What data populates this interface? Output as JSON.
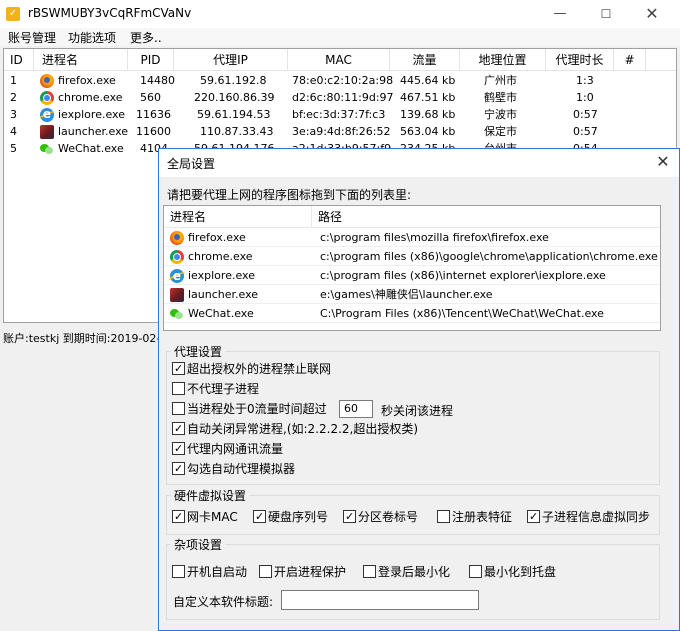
{
  "main_window": {
    "title": "rBSWMUBY3vCqRFmCVaNv",
    "app_icon": "checkmark-shield-icon",
    "menu": [
      "账号管理",
      "功能选项",
      "更多.."
    ],
    "columns": [
      "ID",
      "进程名",
      "PID",
      "代理IP",
      "MAC",
      "流量",
      "地理位置",
      "代理时长",
      "#"
    ],
    "rows": [
      {
        "id": "1",
        "icon": "firefox",
        "name": "firefox.exe",
        "pid": "14480",
        "ip": "59.61.192.8",
        "mac": "78:e0:c2:10:2a:98",
        "traffic": "445.64 kb",
        "location": "广州市",
        "duration": "1:3"
      },
      {
        "id": "2",
        "icon": "chrome",
        "name": "chrome.exe",
        "pid": "560",
        "ip": "220.160.86.39",
        "mac": "d2:6c:80:11:9d:97",
        "traffic": "467.51 kb",
        "location": "鹤壁市",
        "duration": "1:0"
      },
      {
        "id": "3",
        "icon": "ie",
        "name": "iexplore.exe",
        "pid": "11636",
        "ip": "59.61.194.53",
        "mac": "bf:ec:3d:37:7f:c3",
        "traffic": "139.68 kb",
        "location": "宁波市",
        "duration": "0:57"
      },
      {
        "id": "4",
        "icon": "launcher",
        "name": "launcher.exe",
        "pid": "11600",
        "ip": "110.87.33.43",
        "mac": "3e:a9:4d:8f:26:52",
        "traffic": "563.04 kb",
        "location": "保定市",
        "duration": "0:57"
      },
      {
        "id": "5",
        "icon": "wechat",
        "name": "WeChat.exe",
        "pid": "4104",
        "ip": "59.61.194.176",
        "mac": "a2:1d:33:b9:57:f9",
        "traffic": "234.25 kb",
        "location": "台州市",
        "duration": "0:54"
      }
    ],
    "status": "账户:testkj  到期时间:2019-02-"
  },
  "dialog": {
    "title": "全局设置",
    "prompt": "请把要代理上网的程序图标拖到下面的列表里:",
    "list_columns": [
      "进程名",
      "路径"
    ],
    "list_rows": [
      {
        "icon": "firefox",
        "name": "firefox.exe",
        "path": "c:\\program files\\mozilla firefox\\firefox.exe"
      },
      {
        "icon": "chrome",
        "name": "chrome.exe",
        "path": "c:\\program files (x86)\\google\\chrome\\application\\chrome.exe"
      },
      {
        "icon": "ie",
        "name": "iexplore.exe",
        "path": "c:\\program files (x86)\\internet explorer\\iexplore.exe"
      },
      {
        "icon": "launcher",
        "name": "launcher.exe",
        "path": "e:\\games\\神雕侠侣\\launcher.exe"
      },
      {
        "icon": "wechat",
        "name": "WeChat.exe",
        "path": "C:\\Program Files (x86)\\Tencent\\WeChat\\WeChat.exe"
      }
    ],
    "proxy_group": {
      "title": "代理设置",
      "opt_block_unauthorized": {
        "label": "超出授权外的进程禁止联网",
        "checked": true
      },
      "opt_no_child": {
        "label": "不代理子进程",
        "checked": false
      },
      "opt_idle_close_pre": {
        "label": "当进程处于0流量时间超过",
        "checked": false
      },
      "idle_seconds": "60",
      "opt_idle_close_post": "秒关闭该进程",
      "opt_auto_close": {
        "label": "自动关闭异常进程,(如:2.2.2.2,超出授权类)",
        "checked": true
      },
      "opt_lan_traffic": {
        "label": "代理内网通讯流量",
        "checked": true
      },
      "opt_auto_emulator": {
        "label": "勾选自动代理模拟器",
        "checked": true
      }
    },
    "hardware_group": {
      "title": "硬件虚拟设置",
      "opt_nic_mac": {
        "label": "网卡MAC",
        "checked": true
      },
      "opt_disk_serial": {
        "label": "硬盘序列号",
        "checked": true
      },
      "opt_volume_id": {
        "label": "分区卷标号",
        "checked": true
      },
      "opt_registry": {
        "label": "注册表特征",
        "checked": false
      },
      "opt_child_sync": {
        "label": "子进程信息虚拟同步",
        "checked": true
      }
    },
    "misc_group": {
      "title": "杂项设置",
      "opt_autostart": {
        "label": "开机自启动",
        "checked": false
      },
      "opt_protect": {
        "label": "开启进程保护",
        "checked": false
      },
      "opt_minimize_login": {
        "label": "登录后最小化",
        "checked": false
      },
      "opt_tray": {
        "label": "最小化到托盘",
        "checked": false
      },
      "custom_title_label": "自定义本软件标题:",
      "custom_title_value": ""
    }
  }
}
